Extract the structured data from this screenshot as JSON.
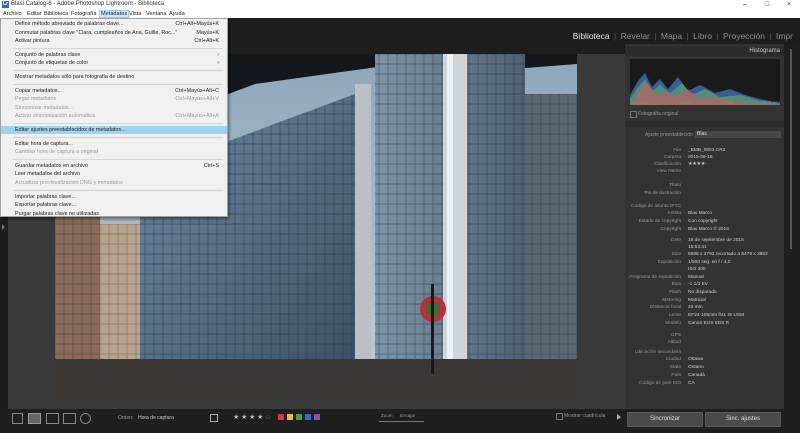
{
  "window": {
    "title": "Blasi Catalog-6 - Adobe Photoshop Lightroom - Biblioteca",
    "minimize": "–",
    "maximize": "□",
    "close": "×"
  },
  "menubar": [
    "Archivo",
    "Editar",
    "Biblioteca",
    "Fotografía",
    "Metadatos",
    "Vista",
    "Ventana",
    "Ayuda"
  ],
  "modules": [
    "Biblioteca",
    "Revelar",
    "Mapa",
    "Libro",
    "Proyección",
    "Impr"
  ],
  "metadata_menu": [
    {
      "label": "Definir método abreviado de palabras clave...",
      "shortcut": "Ctrl+Alt+Mayús+K"
    },
    {
      "label": "Conmutar palabras clave \"Clara, cumpleaños de Ana, Guille, Roc...\"",
      "shortcut": "Mayús+K"
    },
    {
      "label": "Activar pintura",
      "shortcut": "Ctrl+Alt+K"
    },
    {
      "sep": true
    },
    {
      "label": "Conjunto de palabras clave",
      "shortcut": "›"
    },
    {
      "label": "Conjunto de etiquetas de color",
      "shortcut": "›"
    },
    {
      "sep": true
    },
    {
      "label": "Mostrar metadatos sólo para fotografía de destino",
      "shortcut": ""
    },
    {
      "sep": true
    },
    {
      "label": "Copiar metadatos...",
      "shortcut": "Ctrl+Mayús+Alt+C"
    },
    {
      "label": "Pegar metadatos",
      "shortcut": "Ctrl+Mayús+Alt+V",
      "disabled": true
    },
    {
      "label": "Sincronizar metadatos...",
      "shortcut": "",
      "disabled": true
    },
    {
      "label": "Activar sincronización automática",
      "shortcut": "Ctrl+Mayús+Alt+A",
      "disabled": true
    },
    {
      "sep": true
    },
    {
      "label": "Editar ajustes preestablecidos de metadatos...",
      "shortcut": "",
      "highlight": true
    },
    {
      "sep": true
    },
    {
      "label": "Editar hora de captura...",
      "shortcut": ""
    },
    {
      "label": "Cambiar hora de captura a original",
      "shortcut": "",
      "disabled": true
    },
    {
      "sep": true
    },
    {
      "label": "Guardar metadatos en archivo",
      "shortcut": "Ctrl+S"
    },
    {
      "label": "Leer metadatos del archivo",
      "shortcut": ""
    },
    {
      "label": "Actualizar previsualización DNG y metadatos",
      "shortcut": "",
      "disabled": true
    },
    {
      "sep": true
    },
    {
      "label": "Importar palabras clave...",
      "shortcut": ""
    },
    {
      "label": "Exportar palabras clave...",
      "shortcut": ""
    },
    {
      "label": "Purgar palabras clave no utilizadas",
      "shortcut": ""
    }
  ],
  "right_panel": {
    "navigator_title": "Histograma",
    "histogram_labels": [
      "ISO 200",
      "24 mm",
      "f / 4,0",
      "1/500 seg"
    ],
    "original_photo": "Fotografía original",
    "preset_label": "Ajuste preestablecido",
    "preset_value": "Blas",
    "metadata": [
      {
        "label": "File",
        "value": "_BMB_0653.CR2"
      },
      {
        "label": "Carpeta",
        "value": "2015-09-16"
      },
      {
        "label": "Clasificación",
        "value": "★★★★·"
      },
      {
        "label": "View Name",
        "value": ""
      },
      {
        "label": "Título",
        "value": ""
      },
      {
        "label": "Pie de ilustración",
        "value": ""
      },
      {
        "label": "Código de asunto IPTC",
        "value": ""
      },
      {
        "label": "Artista",
        "value": "Blas Marco"
      },
      {
        "label": "Estado de copyright",
        "value": "Con copyright"
      },
      {
        "label": "Copyright",
        "value": "Blas Marco © 2016"
      },
      {
        "label": "Date",
        "value": "16 de septiembre de 2015"
      },
      {
        "label": "",
        "value": "15:53:41"
      },
      {
        "label": "Size",
        "value": "5688 x 3792 recortado a 5479 x 3652"
      },
      {
        "label": "Exposición",
        "value": "1/500 seg. en f / 4,0"
      },
      {
        "label": "",
        "value": "ISO 200"
      },
      {
        "label": "Programa de exposición",
        "value": "Manual"
      },
      {
        "label": "Bias",
        "value": "-1 1/3 EV"
      },
      {
        "label": "Flash",
        "value": "No disparado"
      },
      {
        "label": "Metering",
        "value": "Matricial"
      },
      {
        "label": "Distancia focal",
        "value": "24 mm"
      },
      {
        "label": "Lente",
        "value": "EF24-105mm f/4L IS USM"
      },
      {
        "label": "Modelo",
        "value": "Canon EOS 5DS R"
      },
      {
        "label": "GPS",
        "value": ""
      },
      {
        "label": "Altitud",
        "value": ""
      },
      {
        "label": "Ubicación secundaria",
        "value": ""
      },
      {
        "label": "Ciudad",
        "value": "Ottawa"
      },
      {
        "label": "State",
        "value": "Ontario"
      },
      {
        "label": "País",
        "value": "Canadá"
      },
      {
        "label": "Código de país ISO",
        "value": "CA"
      }
    ]
  },
  "bottom": {
    "orden_label": "Orden:",
    "orden_value": "Hora de captura",
    "zoom_label": "Zoom",
    "encajar_label": "Encajar",
    "mostrar_cuadricula": "Mostrar cuadrícula",
    "sincronizar": "Sincronizar",
    "sinc_ajustes": "Sinc. ajustes"
  },
  "colors": {
    "accent_highlight": "#9ed3f5",
    "label_red": "#d23b3b",
    "label_yellow": "#e5c23a",
    "label_green": "#44a144",
    "label_blue": "#3b69c9",
    "label_purple": "#8e4fb8"
  }
}
